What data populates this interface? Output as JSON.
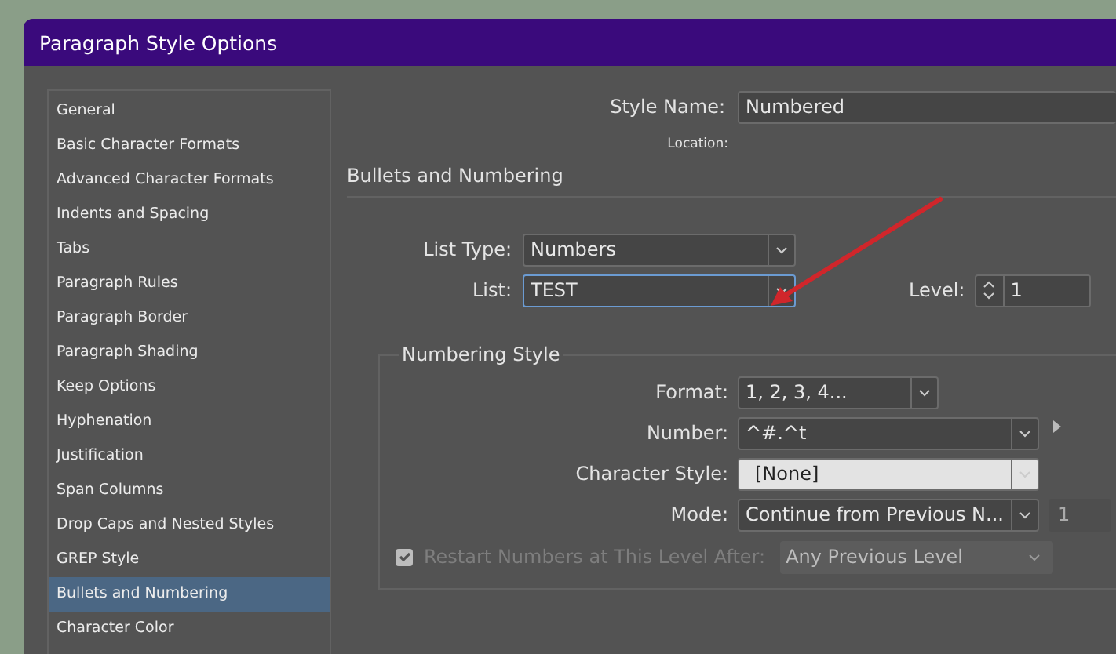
{
  "window": {
    "title": "Paragraph Style Options"
  },
  "sidebar": {
    "items": [
      {
        "label": "General",
        "selected": false
      },
      {
        "label": "Basic Character Formats",
        "selected": false
      },
      {
        "label": "Advanced Character Formats",
        "selected": false
      },
      {
        "label": "Indents and Spacing",
        "selected": false
      },
      {
        "label": "Tabs",
        "selected": false
      },
      {
        "label": "Paragraph Rules",
        "selected": false
      },
      {
        "label": "Paragraph Border",
        "selected": false
      },
      {
        "label": "Paragraph Shading",
        "selected": false
      },
      {
        "label": "Keep Options",
        "selected": false
      },
      {
        "label": "Hyphenation",
        "selected": false
      },
      {
        "label": "Justification",
        "selected": false
      },
      {
        "label": "Span Columns",
        "selected": false
      },
      {
        "label": "Drop Caps and Nested Styles",
        "selected": false
      },
      {
        "label": "GREP Style",
        "selected": false
      },
      {
        "label": "Bullets and Numbering",
        "selected": true
      },
      {
        "label": "Character Color",
        "selected": false
      }
    ]
  },
  "style_name": {
    "label": "Style Name:",
    "value": "Numbered"
  },
  "location": {
    "label": "Location:"
  },
  "section_title": "Bullets and Numbering",
  "list_type": {
    "label": "List Type:",
    "value": "Numbers",
    "focused": false
  },
  "list": {
    "label": "List:",
    "value": "TEST",
    "focused": true
  },
  "level": {
    "label": "Level:",
    "value": "1"
  },
  "numbering_style": {
    "title": "Numbering Style",
    "fields": [
      {
        "kind": "short",
        "label": "Format:",
        "value": "1, 2, 3, 4..."
      },
      {
        "kind": "flyout",
        "label": "Number:",
        "value": "^#.^t"
      },
      {
        "kind": "light",
        "label": "Character Style:",
        "value": "[None]"
      },
      {
        "kind": "extra",
        "label": "Mode:",
        "value": "Continue from Previous N...",
        "extra": "1"
      }
    ],
    "restart": {
      "label": "Restart Numbers at This Level After:",
      "checked": true,
      "disabled": true,
      "value": "Any Previous Level"
    }
  }
}
